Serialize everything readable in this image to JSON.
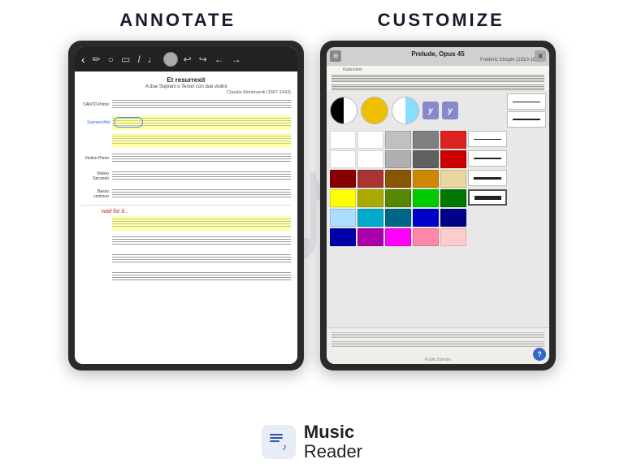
{
  "header": {
    "annotate_label": "ANNOTATE",
    "customize_label": "CUSTOMIZE"
  },
  "left_tablet": {
    "title": "Et resurrexit",
    "subtitle": "A due Soprani o Tenori con due violini",
    "composer": "Claudio Monteverdi (1567-1643)",
    "toolbar_buttons": [
      "‹",
      "✏",
      "◯",
      "◻",
      "I",
      "♩",
      "●",
      "↩",
      "↪",
      "←",
      "→"
    ],
    "staff_rows": [
      {
        "label": "CANTO Primo"
      },
      {
        "label": "Soprano/Alto",
        "highlighted": true,
        "annotated": true
      },
      {
        "label": "Violino Primo"
      },
      {
        "label": "Violino Secondo"
      },
      {
        "label": "Basso continuo"
      }
    ],
    "wait_text": "wait for it...",
    "bottom_staff_rows": 4
  },
  "right_tablet": {
    "score_title": "Prelude, Opus 45",
    "score_composer": "Frédéric Chopin (1810-1849)",
    "score_label": "Rubinstein",
    "grid_icon": "⊞",
    "close_icon": "✕",
    "help_icon": "?",
    "public_domain": "Public Domain",
    "top_swatches": [
      {
        "type": "half-black-white",
        "label": "black-white swatch"
      },
      {
        "type": "yellow",
        "label": "yellow swatch"
      },
      {
        "type": "cyan-half",
        "label": "cyan-white swatch"
      }
    ],
    "y_buttons": [
      "y",
      "y"
    ],
    "color_rows": [
      [
        "#ffffff",
        "#d0d0d0",
        "#a0a0a0",
        "#e02020",
        "#ffffff"
      ],
      [
        "#ffffff",
        "#b0b0b0",
        "#707070",
        "#cc0000",
        "#ffffff"
      ],
      [
        "#880000",
        "#aa3333",
        "#885500",
        "#cc8800",
        "#e8d8a0",
        "#ffffff"
      ],
      [
        "#ffff00",
        "#aaaa00",
        "#558800",
        "#00cc00",
        "#007700",
        "#ffffff"
      ],
      [
        "#aaddff",
        "#00aacc",
        "#006688",
        "#0000cc",
        "#000088",
        "#ffffff"
      ],
      [
        "#0000aa",
        "#aa00aa",
        "#ff00ff",
        "#ff88aa",
        "#ffcccc",
        "#ffffff"
      ]
    ],
    "line_weights": [
      "thin",
      "medium",
      "thick",
      "extra-thick"
    ]
  },
  "footer": {
    "app_name": "Music",
    "app_sub": "Reader",
    "icon_symbol": "♫"
  }
}
